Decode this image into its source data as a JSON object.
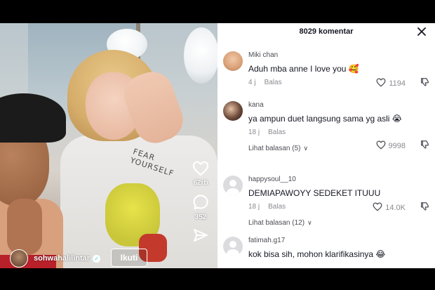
{
  "video": {
    "shirt_text": "FEAR YOURSELF",
    "likes": "62rb",
    "comments": "352",
    "author": "sohwahalilintar",
    "follow_label": "Ikuti"
  },
  "panel": {
    "title": "8029 komentar",
    "comments": [
      {
        "username": "Miki chan",
        "text": "Aduh mba anne I love you 🥰",
        "time": "4 j",
        "reply_label": "Balas",
        "likes": "1194",
        "view_replies": ""
      },
      {
        "username": "kana",
        "text": "ya ampun duet langsung sama yg asli 😭",
        "time": "18 j",
        "reply_label": "Balas",
        "likes": "9998",
        "view_replies": "Lihat balasan (5)"
      },
      {
        "username": "happysoul__10",
        "text": "DEMIAPAWOYY SEDEKET ITUUU",
        "time": "18 j",
        "reply_label": "Balas",
        "likes": "14.0K",
        "view_replies": "Lihat balasan (12)"
      },
      {
        "username": "fatimah.g17",
        "text": "kok bisa sih, mohon klarifikasinya 😂",
        "time": "",
        "reply_label": "",
        "likes": "",
        "view_replies": ""
      }
    ]
  }
}
